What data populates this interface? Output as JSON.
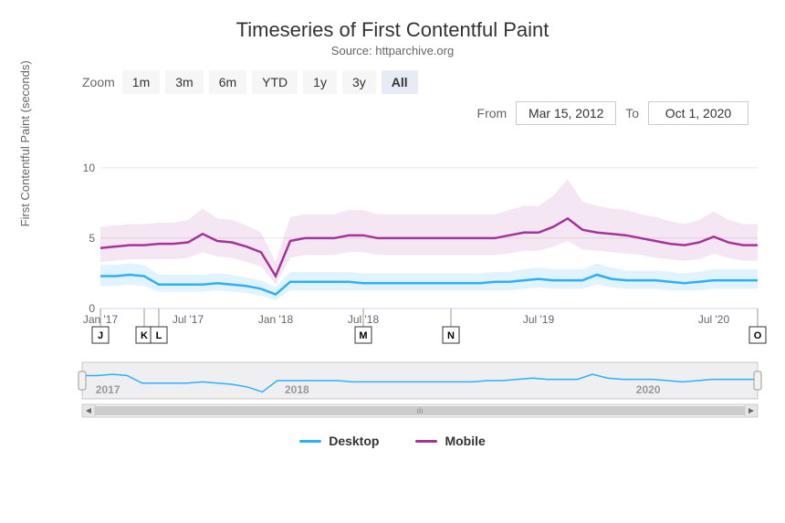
{
  "title": "Timeseries of First Contentful Paint",
  "subtitle": "Source: httparchive.org",
  "zoom": {
    "label": "Zoom",
    "buttons": [
      "1m",
      "3m",
      "6m",
      "YTD",
      "1y",
      "3y",
      "All"
    ],
    "active": "All"
  },
  "date_range": {
    "from_label": "From",
    "to_label": "To",
    "from": "Mar 15, 2012",
    "to": "Oct 1, 2020"
  },
  "yaxis_label": "First Contentful Paint (seconds)",
  "y_ticks": [
    "0",
    "5",
    "10"
  ],
  "x_ticks": [
    "Jan '17",
    "Jul '17",
    "Jan '18",
    "Jul '18",
    "Jul '19",
    "Jul '20"
  ],
  "flags": [
    "J",
    "K",
    "L",
    "M",
    "N",
    "O"
  ],
  "nav_years": [
    "2017",
    "2018",
    "2020"
  ],
  "legend": {
    "desktop": "Desktop",
    "mobile": "Mobile"
  },
  "chart_data": {
    "type": "line",
    "title": "Timeseries of First Contentful Paint",
    "xlabel": "",
    "ylabel": "First Contentful Paint (seconds)",
    "ylim": [
      0,
      12
    ],
    "x": [
      "Jan '17",
      "Feb '17",
      "Mar '17",
      "Apr '17",
      "May '17",
      "Jun '17",
      "Jul '17",
      "Aug '17",
      "Sep '17",
      "Oct '17",
      "Nov '17",
      "Dec '17",
      "Jan '18",
      "Feb '18",
      "Mar '18",
      "Apr '18",
      "May '18",
      "Jun '18",
      "Jul '18",
      "Aug '18",
      "Sep '18",
      "Oct '18",
      "Nov '18",
      "Dec '18",
      "Jan '19",
      "Feb '19",
      "Mar '19",
      "Apr '19",
      "May '19",
      "Jun '19",
      "Jul '19",
      "Aug '19",
      "Sep '19",
      "Oct '19",
      "Nov '19",
      "Dec '19",
      "Jan '20",
      "Feb '20",
      "Mar '20",
      "Apr '20",
      "May '20",
      "Jun '20",
      "Jul '20",
      "Aug '20",
      "Sep '20",
      "Oct '20"
    ],
    "series": [
      {
        "name": "Desktop",
        "values": [
          2.3,
          2.3,
          2.4,
          2.3,
          1.7,
          1.7,
          1.7,
          1.7,
          1.8,
          1.7,
          1.6,
          1.4,
          1.0,
          1.9,
          1.9,
          1.9,
          1.9,
          1.9,
          1.8,
          1.8,
          1.8,
          1.8,
          1.8,
          1.8,
          1.8,
          1.8,
          1.8,
          1.9,
          1.9,
          2.0,
          2.1,
          2.0,
          2.0,
          2.0,
          2.4,
          2.1,
          2.0,
          2.0,
          2.0,
          1.9,
          1.8,
          1.9,
          2.0,
          2.0,
          2.0,
          2.0
        ],
        "band_low": [
          1.6,
          1.6,
          1.7,
          1.6,
          1.2,
          1.2,
          1.2,
          1.2,
          1.3,
          1.2,
          1.1,
          0.9,
          0.6,
          1.3,
          1.3,
          1.3,
          1.3,
          1.3,
          1.3,
          1.3,
          1.3,
          1.3,
          1.3,
          1.3,
          1.3,
          1.3,
          1.3,
          1.3,
          1.3,
          1.4,
          1.5,
          1.4,
          1.4,
          1.4,
          1.7,
          1.5,
          1.4,
          1.4,
          1.4,
          1.3,
          1.3,
          1.3,
          1.4,
          1.4,
          1.4,
          1.4
        ],
        "band_high": [
          3.1,
          3.1,
          3.2,
          3.1,
          2.4,
          2.4,
          2.4,
          2.4,
          2.5,
          2.4,
          2.2,
          2.0,
          1.5,
          2.6,
          2.6,
          2.6,
          2.6,
          2.6,
          2.5,
          2.5,
          2.5,
          2.5,
          2.5,
          2.5,
          2.5,
          2.5,
          2.5,
          2.6,
          2.6,
          2.8,
          2.9,
          2.8,
          2.8,
          2.8,
          3.2,
          2.9,
          2.7,
          2.7,
          2.7,
          2.6,
          2.5,
          2.6,
          2.8,
          2.8,
          2.8,
          2.8
        ]
      },
      {
        "name": "Mobile",
        "values": [
          4.3,
          4.4,
          4.5,
          4.5,
          4.6,
          4.6,
          4.7,
          5.3,
          4.8,
          4.7,
          4.4,
          4.0,
          2.3,
          4.8,
          5.0,
          5.0,
          5.0,
          5.2,
          5.2,
          5.0,
          5.0,
          5.0,
          5.0,
          5.0,
          5.0,
          5.0,
          5.0,
          5.0,
          5.2,
          5.4,
          5.4,
          5.8,
          6.4,
          5.6,
          5.4,
          5.3,
          5.2,
          5.0,
          4.8,
          4.6,
          4.5,
          4.7,
          5.1,
          4.7,
          4.5,
          4.5
        ],
        "band_low": [
          3.3,
          3.4,
          3.5,
          3.5,
          3.5,
          3.5,
          3.6,
          4.0,
          3.7,
          3.6,
          3.3,
          3.0,
          1.7,
          3.6,
          3.8,
          3.8,
          3.8,
          4.0,
          4.0,
          3.8,
          3.8,
          3.8,
          3.8,
          3.8,
          3.8,
          3.8,
          3.8,
          3.8,
          3.9,
          4.1,
          4.1,
          4.4,
          4.8,
          4.2,
          4.1,
          4.0,
          3.9,
          3.8,
          3.6,
          3.5,
          3.4,
          3.5,
          3.9,
          3.6,
          3.4,
          3.4
        ],
        "band_high": [
          5.8,
          5.9,
          6.0,
          6.0,
          6.1,
          6.1,
          6.3,
          7.1,
          6.4,
          6.3,
          5.9,
          5.4,
          3.3,
          6.5,
          6.7,
          6.7,
          6.7,
          7.0,
          7.0,
          6.7,
          6.7,
          6.7,
          6.7,
          6.7,
          6.7,
          6.7,
          6.7,
          6.7,
          7.0,
          7.3,
          7.3,
          8.0,
          9.2,
          7.6,
          7.3,
          7.1,
          7.0,
          6.7,
          6.5,
          6.2,
          6.0,
          6.3,
          6.9,
          6.3,
          6.0,
          6.0
        ]
      }
    ],
    "flags": [
      {
        "label": "J",
        "x": "Jan '17"
      },
      {
        "label": "K",
        "x": "Apr '17"
      },
      {
        "label": "L",
        "x": "May '17"
      },
      {
        "label": "M",
        "x": "Jul '18"
      },
      {
        "label": "N",
        "x": "Jan '19"
      },
      {
        "label": "O",
        "x": "Oct '20"
      }
    ],
    "navigator_range": [
      "2012",
      "2020"
    ]
  }
}
